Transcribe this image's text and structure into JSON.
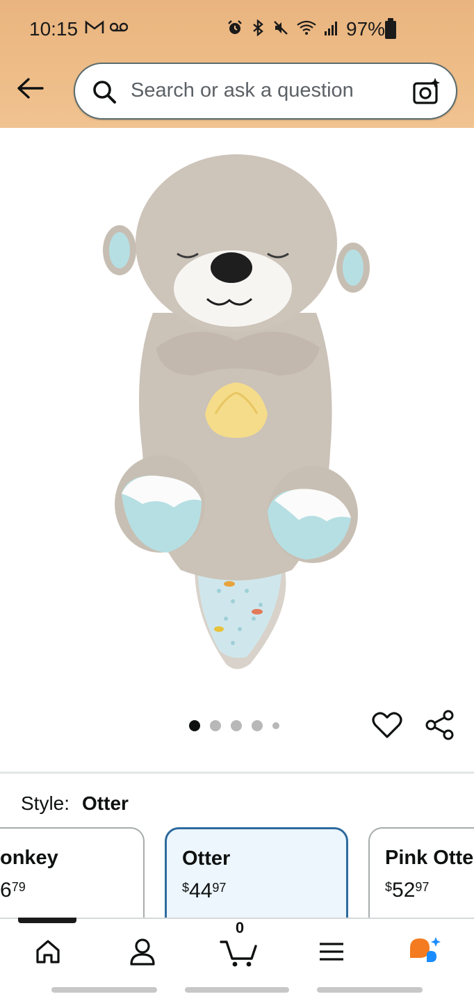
{
  "status_bar": {
    "time": "10:15",
    "battery": "97%"
  },
  "header": {
    "search_placeholder": "Search or ask a question"
  },
  "gallery": {
    "image_count": 5,
    "active_index": 0
  },
  "style": {
    "label": "Style:",
    "value": "Otter"
  },
  "variants": [
    {
      "name": "onkey",
      "price_symbol": "",
      "price_whole": "6",
      "price_fraction": "79",
      "selected": false
    },
    {
      "name": "Otter",
      "price_symbol": "$",
      "price_whole": "44",
      "price_fraction": "97",
      "selected": true
    },
    {
      "name": "Pink Otte",
      "price_symbol": "$",
      "price_whole": "52",
      "price_fraction": "97",
      "selected": false
    }
  ],
  "bottom_nav": {
    "items": [
      "home-icon",
      "account-icon",
      "cart-icon",
      "menu-icon",
      "rufus-icon"
    ],
    "cart_count": "0"
  },
  "colors": {
    "header_bg": "#eebd88",
    "selected_border": "#2d6a9e",
    "selected_bg": "#edf6fd",
    "rufus_orange": "#f47b20",
    "rufus_blue": "#1a8cff"
  }
}
